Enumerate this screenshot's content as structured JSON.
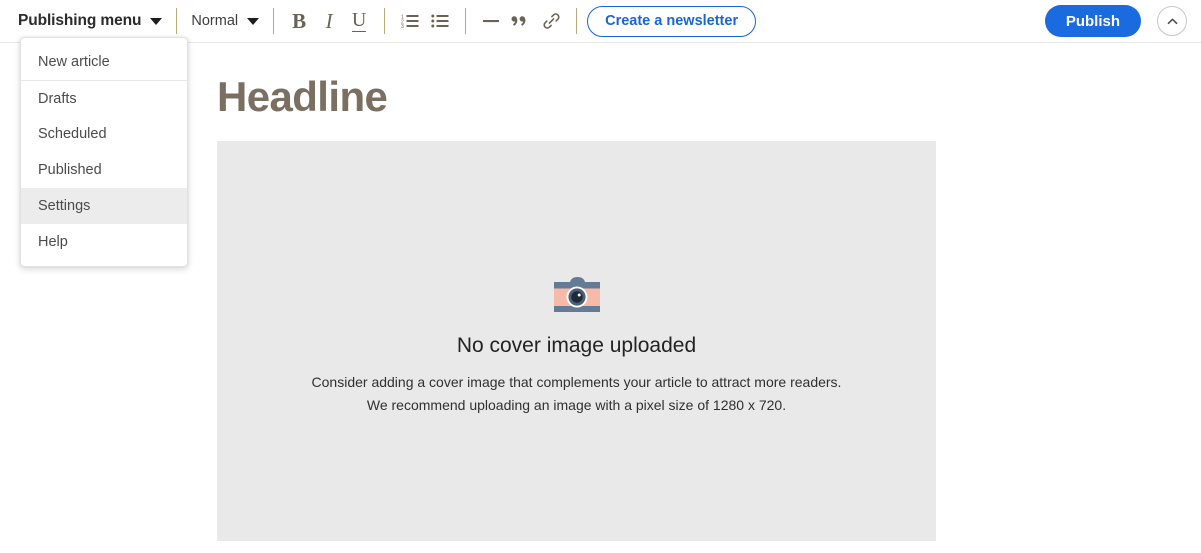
{
  "toolbar": {
    "publishing_menu_label": "Publishing menu",
    "publishing_menu_caret_icon": "chevron-down-icon",
    "style_label": "Normal",
    "style_caret_icon": "chevron-down-icon",
    "bold_label": "B",
    "italic_label": "I",
    "underline_label": "U",
    "ordered_list_icon": "numbered-list-icon",
    "unordered_list_icon": "bulleted-list-icon",
    "horizontal_rule_icon": "horizontal-rule-icon",
    "blockquote_icon": "quote-icon",
    "link_icon": "link-icon",
    "newsletter_label": "Create a newsletter",
    "publish_label": "Publish",
    "collapse_icon": "chevron-up-icon"
  },
  "menu": {
    "items": [
      {
        "label": "New article",
        "active": false,
        "divided": false
      },
      {
        "label": "Drafts",
        "active": false,
        "divided": true
      },
      {
        "label": "Scheduled",
        "active": false,
        "divided": false
      },
      {
        "label": "Published",
        "active": false,
        "divided": false
      },
      {
        "label": "Settings",
        "active": true,
        "divided": false
      },
      {
        "label": "Help",
        "active": false,
        "divided": false
      }
    ]
  },
  "editor": {
    "headline_placeholder": "Headline",
    "cover": {
      "icon": "camera-icon",
      "title": "No cover image uploaded",
      "line1": "Consider adding a cover image that complements your article to attract more readers.",
      "line2": "We recommend uploading an image with a pixel size of 1280 x 720."
    }
  },
  "colors": {
    "accent_blue": "#1a6ae0",
    "link_blue": "#1a65d4",
    "toolbar_icon": "#6b6456",
    "divider_tan": "#bda981",
    "placeholder_brown": "#7a6f60",
    "cover_bg": "#e9e9e9",
    "camera_body": "#f7b9a8",
    "camera_band": "#647b96",
    "camera_lens": "#2e3d4f"
  }
}
